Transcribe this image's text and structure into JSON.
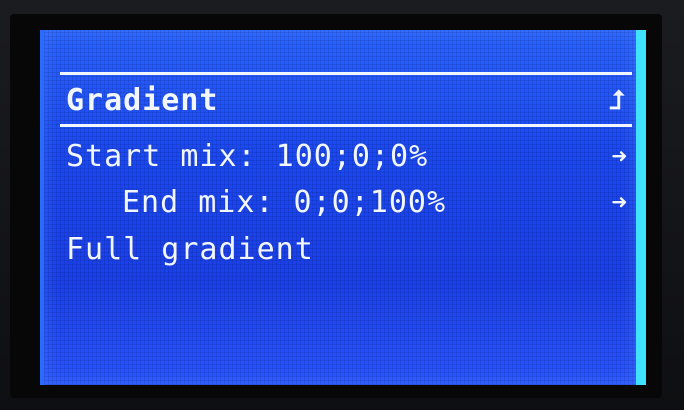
{
  "menu": {
    "title": "Gradient",
    "back_icon": "return-up-arrow",
    "back_glyph": "⮥",
    "items": [
      {
        "label": "Start mix: 100;0;0%",
        "icon": "right-arrow",
        "glyph": "➜"
      },
      {
        "label": "End mix: 0;0;100%",
        "icon": "right-arrow",
        "glyph": "➜"
      },
      {
        "label": "Full gradient"
      }
    ]
  },
  "colors": {
    "lcd_background": "#1b48f0",
    "lcd_text": "#f2f6ff",
    "backlight_edge": "#3fe2ff"
  }
}
